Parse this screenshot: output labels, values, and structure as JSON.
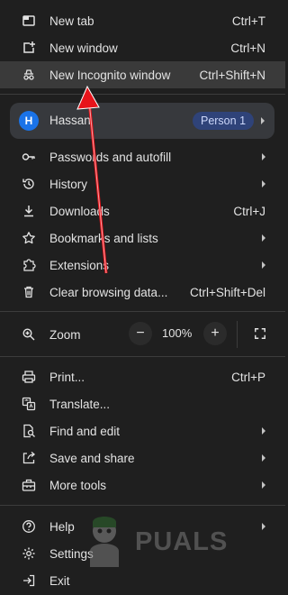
{
  "menu": {
    "new_tab": {
      "label": "New tab",
      "shortcut": "Ctrl+T",
      "icon": "new-tab-icon"
    },
    "new_window": {
      "label": "New window",
      "shortcut": "Ctrl+N",
      "icon": "new-window-icon"
    },
    "new_incognito": {
      "label": "New Incognito window",
      "shortcut": "Ctrl+Shift+N",
      "icon": "incognito-icon"
    },
    "profile": {
      "initial": "H",
      "name": "Hassan",
      "badge": "Person 1"
    },
    "passwords": {
      "label": "Passwords and autofill",
      "icon": "key-icon"
    },
    "history": {
      "label": "History",
      "icon": "history-icon"
    },
    "downloads": {
      "label": "Downloads",
      "shortcut": "Ctrl+J",
      "icon": "download-icon"
    },
    "bookmarks": {
      "label": "Bookmarks and lists",
      "icon": "star-icon"
    },
    "extensions": {
      "label": "Extensions",
      "icon": "puzzle-icon"
    },
    "clear_data": {
      "label": "Clear browsing data...",
      "shortcut": "Ctrl+Shift+Del",
      "icon": "trash-icon"
    },
    "zoom": {
      "label": "Zoom",
      "minus": "−",
      "value": "100%",
      "plus": "+",
      "icon": "zoom-icon"
    },
    "print": {
      "label": "Print...",
      "shortcut": "Ctrl+P",
      "icon": "print-icon"
    },
    "translate": {
      "label": "Translate...",
      "icon": "translate-icon"
    },
    "find_edit": {
      "label": "Find and edit",
      "icon": "find-icon"
    },
    "save_share": {
      "label": "Save and share",
      "icon": "save-share-icon"
    },
    "more_tools": {
      "label": "More tools",
      "icon": "toolbox-icon"
    },
    "help": {
      "label": "Help",
      "icon": "help-icon"
    },
    "settings": {
      "label": "Settings",
      "icon": "settings-icon"
    },
    "exit": {
      "label": "Exit",
      "icon": "exit-icon"
    }
  },
  "watermark": {
    "text": "PUALS"
  },
  "colors": {
    "background": "#1f1f1f",
    "hover": "#3a3a3a",
    "profile_bg": "#37393d",
    "badge_bg": "#2f4379",
    "arrow": "#e8141b"
  }
}
